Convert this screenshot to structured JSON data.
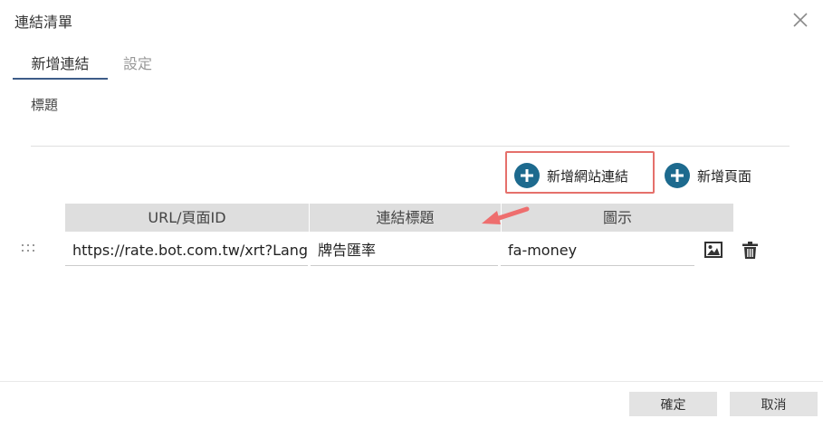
{
  "dialog": {
    "title": "連結清單"
  },
  "tabs": [
    {
      "label": "新增連結",
      "active": true
    },
    {
      "label": "設定",
      "active": false
    }
  ],
  "form": {
    "title_label": "標題"
  },
  "actions": {
    "add_site_label": "新增網站連結",
    "add_page_label": "新增頁面"
  },
  "table": {
    "headers": [
      "URL/頁面ID",
      "連結標題",
      "圖示"
    ],
    "rows": [
      {
        "url": "https://rate.bot.com.tw/xrt?Lang=",
        "title": "牌告匯率",
        "icon": "fa-money"
      }
    ]
  },
  "footer": {
    "ok_label": "確定",
    "cancel_label": "取消"
  },
  "icons": {
    "close": "close-icon",
    "add": "plus-circle-icon",
    "drag": "drag-handle-icon",
    "image": "image-icon",
    "trash": "trash-icon",
    "annotation": "arrow-annotation"
  },
  "colors": {
    "accent": "#1d6a8e",
    "tab_underline": "#3d5c88",
    "highlight_border": "#e5706b",
    "arrow": "#ee6e6e",
    "header_bg": "#dedede",
    "button_bg": "#e3e3e3"
  }
}
